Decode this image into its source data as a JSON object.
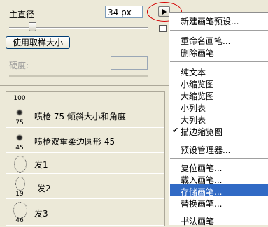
{
  "panel": {
    "diameter_label": "主直径",
    "diameter_value": "34 px",
    "sample_button": "使用取样大小",
    "hardness_label": "硬度:"
  },
  "brushes": [
    {
      "size": "100",
      "name": ""
    },
    {
      "size": "75",
      "name": "喷枪 75 倾斜大小和角度"
    },
    {
      "size": "45",
      "name": "喷枪双重柔边圆形 45"
    },
    {
      "size": "",
      "name": "发1"
    },
    {
      "size": "19",
      "name": "发2"
    },
    {
      "size": "46",
      "name": "发3"
    }
  ],
  "menu": {
    "items": [
      "新建画笔预设...",
      "重命名画笔...",
      "删除画笔",
      "纯文本",
      "小缩览图",
      "大缩览图",
      "小列表",
      "大列表",
      "描边缩览图",
      "预设管理器...",
      "复位画笔...",
      "载入画笔...",
      "存储画笔...",
      "替换画笔...",
      "书法画笔"
    ],
    "checked_item": "描边缩览图",
    "highlighted_item": "存储画笔..."
  },
  "colors": {
    "highlight": "#316ac5",
    "annotation_circle": "#d40000"
  }
}
